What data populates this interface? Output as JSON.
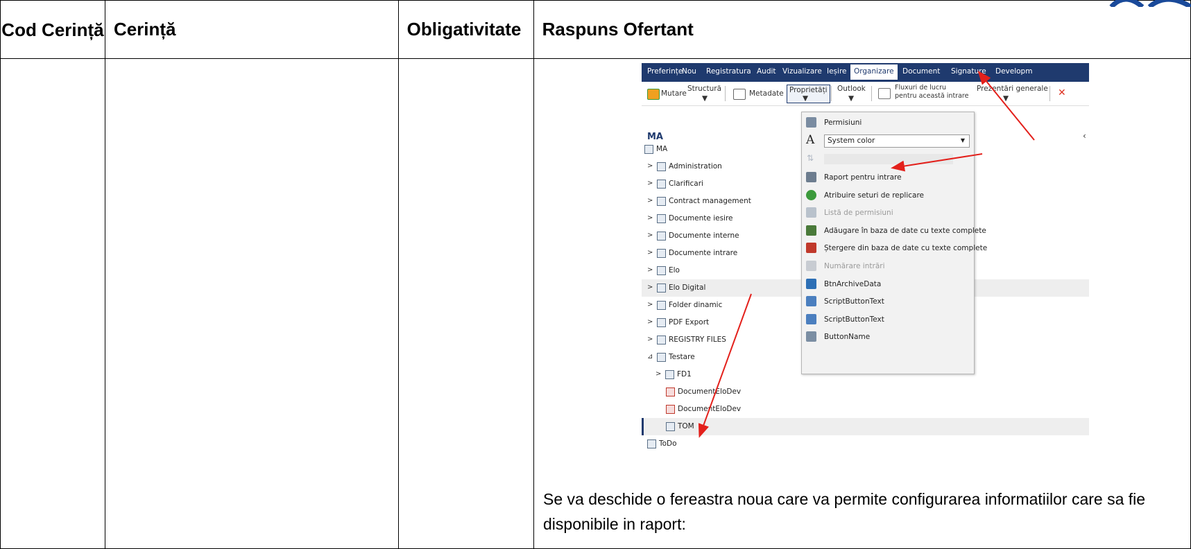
{
  "table": {
    "headers": {
      "cod": "Cod Cerință",
      "cerinta": "Cerință",
      "obligativitate": "Obligativitate",
      "raspuns": "Raspuns Ofertant"
    }
  },
  "screenshot": {
    "menu": [
      "Preferințe",
      "Nou",
      "Registratura",
      "Audit",
      "Vizualizare",
      "Ieșire",
      "Organizare",
      "Document",
      "Signature",
      "Developm"
    ],
    "active_menu": "Organizare",
    "toolbar": {
      "mutare": "Mutare",
      "structura": "Structură",
      "metadate": "Metadate",
      "proprietati": "Proprietăți",
      "outlook": "Outlook",
      "fluxuri_line1": "Fluxuri de lucru",
      "fluxuri_line2": "pentru această intrare",
      "prezentari": "Prezentări generale"
    },
    "panel_title": "MA",
    "tree": [
      {
        "label": "MA",
        "chevron": ""
      },
      {
        "label": "Administration",
        "chevron": ">"
      },
      {
        "label": "Clarificari",
        "chevron": ">"
      },
      {
        "label": "Contract management",
        "chevron": ">"
      },
      {
        "label": "Documente iesire",
        "chevron": ">"
      },
      {
        "label": "Documente interne",
        "chevron": ">"
      },
      {
        "label": "Documente intrare",
        "chevron": ">"
      },
      {
        "label": "Elo",
        "chevron": ">"
      },
      {
        "label": "Elo Digital",
        "chevron": ">"
      },
      {
        "label": "Folder dinamic",
        "chevron": ">"
      },
      {
        "label": "PDF Export",
        "chevron": ">"
      },
      {
        "label": "REGISTRY FILES",
        "chevron": ">"
      },
      {
        "label": "Testare",
        "chevron": "⊿"
      },
      {
        "label": "FD1",
        "chevron": ">"
      },
      {
        "label": "DocumentEloDev",
        "chevron": ""
      },
      {
        "label": "DocumentEloDev",
        "chevron": ""
      },
      {
        "label": "TOM",
        "chevron": ""
      },
      {
        "label": "ToDo",
        "chevron": ""
      }
    ],
    "context_menu": {
      "permisiuni": "Permisiuni",
      "system_color": "System color",
      "items": [
        {
          "label": "Raport pentru intrare",
          "disabled": false,
          "icon_color": "#6d7d8f"
        },
        {
          "label": "Atribuire seturi de replicare",
          "disabled": false,
          "icon_color": "#3c9a3c"
        },
        {
          "label": "Listă de permisiuni",
          "disabled": true,
          "icon_color": "#b9c2cc"
        },
        {
          "label": "Adăugare în baza de date cu texte complete",
          "disabled": false,
          "icon_color": "#4a7a3a"
        },
        {
          "label": "Ștergere din baza de date cu texte complete",
          "disabled": false,
          "icon_color": "#c0392b"
        },
        {
          "label": "Numărare intrări",
          "disabled": true,
          "icon_color": "#c8ccd2"
        },
        {
          "label": "BtnArchiveData",
          "disabled": false,
          "icon_color": "#2d6fb5"
        },
        {
          "label": "ScriptButtonText",
          "disabled": false,
          "icon_color": "#4b7fbf"
        },
        {
          "label": "ScriptButtonText",
          "disabled": false,
          "icon_color": "#4b7fbf"
        },
        {
          "label": "ButtonName",
          "disabled": false,
          "icon_color": "#7b8ea3"
        }
      ]
    }
  },
  "paragraph": "Se va deschide o fereastra noua care va permite configurarea informatiilor care sa fie disponibile in raport:",
  "colors": {
    "brand_navy": "#1f3a6e",
    "arrow_red": "#e3201b"
  }
}
